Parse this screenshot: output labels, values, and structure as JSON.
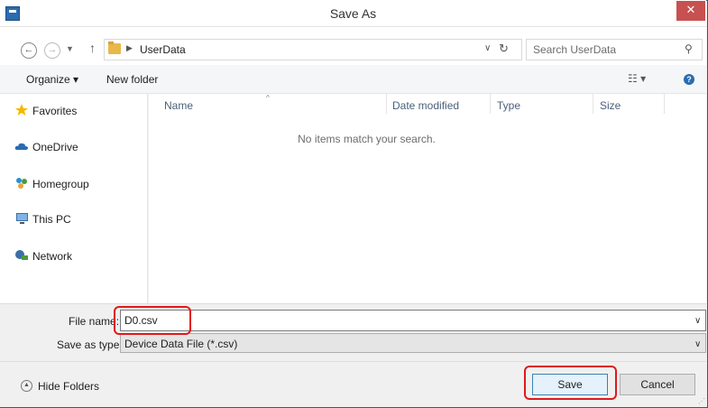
{
  "window": {
    "title": "Save As",
    "close_label": "✕"
  },
  "address": {
    "crumb": "UserData",
    "search_placeholder": "Search UserData"
  },
  "toolbar": {
    "organize_label": "Organize ▾",
    "new_folder_label": "New folder",
    "view_label": "☷ ▾",
    "help_label": "?"
  },
  "nav": {
    "items": [
      {
        "label": "Favorites",
        "icon": "star-icon",
        "color": "#f5b800"
      },
      {
        "label": "OneDrive",
        "icon": "cloud-icon",
        "color": "#2b6bb0"
      },
      {
        "label": "Homegroup",
        "icon": "homegroup-icon",
        "color": "#4a9a3d"
      },
      {
        "label": "This PC",
        "icon": "computer-icon",
        "color": "#3a6ea5"
      },
      {
        "label": "Network",
        "icon": "network-icon",
        "color": "#3a6ea5"
      }
    ]
  },
  "filelist": {
    "columns": [
      "Name",
      "Date modified",
      "Type",
      "Size"
    ],
    "empty_message": "No items match your search."
  },
  "fields": {
    "file_name_label": "File name:",
    "file_name_value": "D0.csv",
    "save_type_label": "Save as type:",
    "save_type_value": "Device Data File (*.csv)"
  },
  "footer": {
    "hide_folders_label": "Hide Folders",
    "save_label": "Save",
    "cancel_label": "Cancel"
  },
  "colors": {
    "highlight": "#e0191c",
    "accent": "#2b6bb0"
  }
}
